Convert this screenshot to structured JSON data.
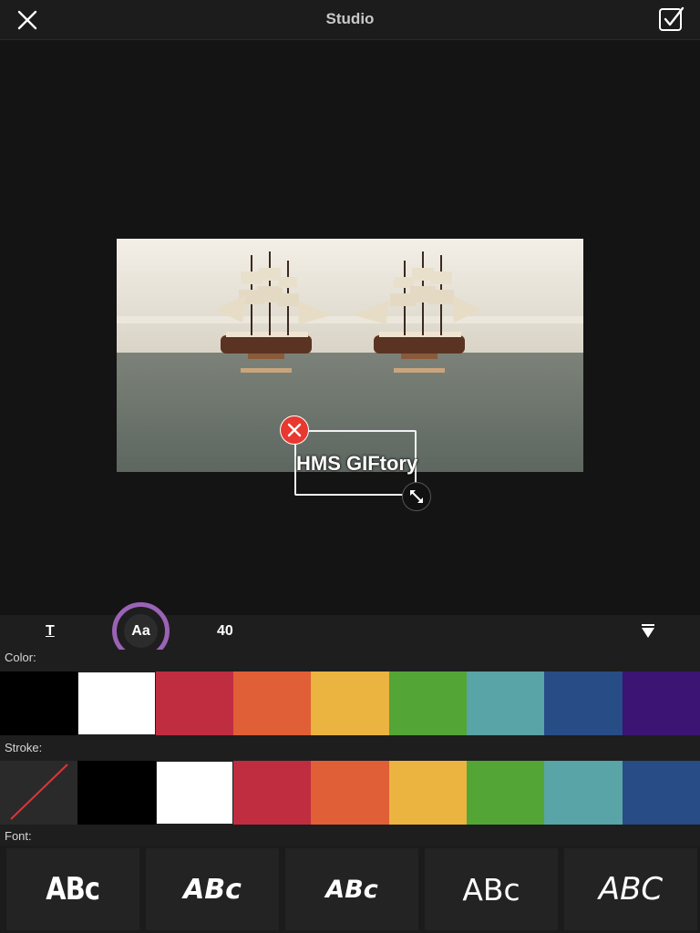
{
  "header": {
    "title": "Studio",
    "close_icon": "close-icon",
    "done_icon": "checkbox-done-icon"
  },
  "preview": {
    "caption": "HMS GIFtory",
    "delete_icon": "close-icon",
    "resize_icon": "resize-diagonal-icon"
  },
  "toolbar": {
    "text_tool_label": "T",
    "font_tool_label": "Aa",
    "size_label": "40",
    "collapse_icon": "triangle-down-icon",
    "accent": "#9a63b6"
  },
  "color_section": {
    "label": "Color:",
    "swatches": [
      "#000000",
      "#ffffff",
      "#c02d40",
      "#e05f36",
      "#ebb33f",
      "#53a536",
      "#58a4a6",
      "#274c86",
      "#3b1474"
    ]
  },
  "stroke_section": {
    "label": "Stroke:",
    "none_icon": "no-stroke-icon",
    "swatches": [
      "#000000",
      "#ffffff",
      "#c02d40",
      "#e05f36",
      "#ebb33f",
      "#53a536",
      "#58a4a6",
      "#274c86"
    ]
  },
  "font_section": {
    "label": "Font:",
    "samples": [
      "ABc",
      "ABc",
      "ABc",
      "ABc",
      "ABC"
    ]
  }
}
